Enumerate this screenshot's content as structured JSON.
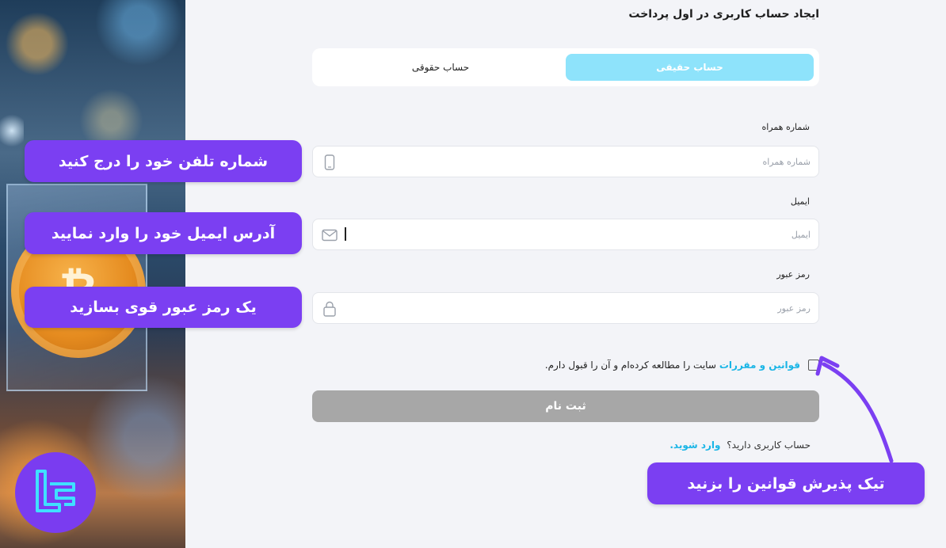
{
  "header": {
    "title": "ایجاد حساب کاربری در اول پرداخت"
  },
  "tabs": {
    "natural": "حساب حقیقی",
    "legal": "حساب حقوقی"
  },
  "fields": {
    "phone": {
      "label": "شماره همراه",
      "placeholder": "شماره همراه",
      "icon": "mobile-phone-icon"
    },
    "email": {
      "label": "ایمیل",
      "placeholder": "ایمیل",
      "icon": "envelope-icon"
    },
    "password": {
      "label": "رمز عبور",
      "placeholder": "رمز عبور",
      "icon": "lock-icon"
    }
  },
  "terms": {
    "link": "قوانین و مقررات",
    "text": "سایت را مطالعه کرده‌ام و آن را قبول دارم."
  },
  "submit": {
    "label": "ثبت نام"
  },
  "login": {
    "question": "حساب کاربری دارید؟",
    "link": "وارد شوید."
  },
  "callouts": {
    "phone": "شماره تلفن خود را درج کنید",
    "email": "آدرس ایمیل خود را وارد نمایید",
    "password": "یک رمز عبور قوی بسازید",
    "terms": "تیک پذیرش قوانین را بزنید"
  },
  "colors": {
    "active_tab": "#8ee3fb",
    "link": "#19b5e6",
    "callout": "#7b3ff2",
    "submit_disabled": "#a7a7a7",
    "background": "#f3f4f8"
  }
}
